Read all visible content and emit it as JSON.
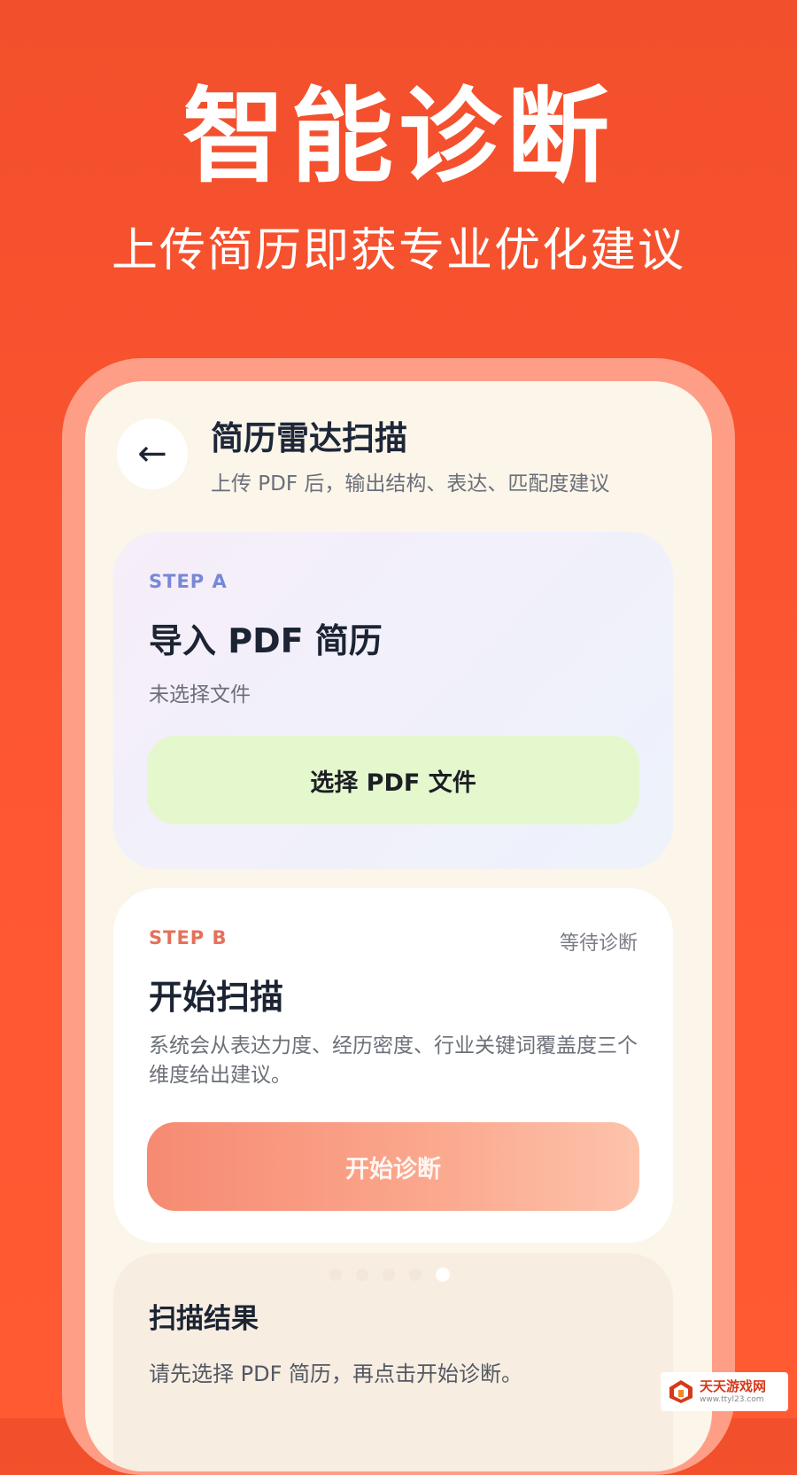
{
  "hero": {
    "title": "智能诊断",
    "subtitle": "上传简历即获专业优化建议"
  },
  "header": {
    "back_icon": "left-arrow-icon",
    "back_glyph": "←",
    "title": "简历雷达扫描",
    "subtitle": "上传 PDF 后，输出结构、表达、匹配度建议"
  },
  "step_a": {
    "label": "STEP A",
    "title": "导入 PDF 简历",
    "status": "未选择文件",
    "button_label": "选择 PDF 文件"
  },
  "step_b": {
    "label": "STEP B",
    "status": "等待诊断",
    "title": "开始扫描",
    "description": "系统会从表达力度、经历密度、行业关键词覆盖度三个维度给出建议。",
    "button_label": "开始诊断"
  },
  "carousel": {
    "count": 5,
    "active_index": 4
  },
  "result": {
    "title": "扫描结果",
    "description": "请先选择 PDF 简历，再点击开始诊断。"
  },
  "watermark": {
    "name": "天天游戏网",
    "url": "www.ttyl23.com"
  },
  "colors": {
    "background": "#ff5733",
    "accent_blue": "#7688d6",
    "accent_orange": "#e5705a",
    "select_button": "#e5f7cd",
    "diagnose_button": "#f68a72"
  }
}
